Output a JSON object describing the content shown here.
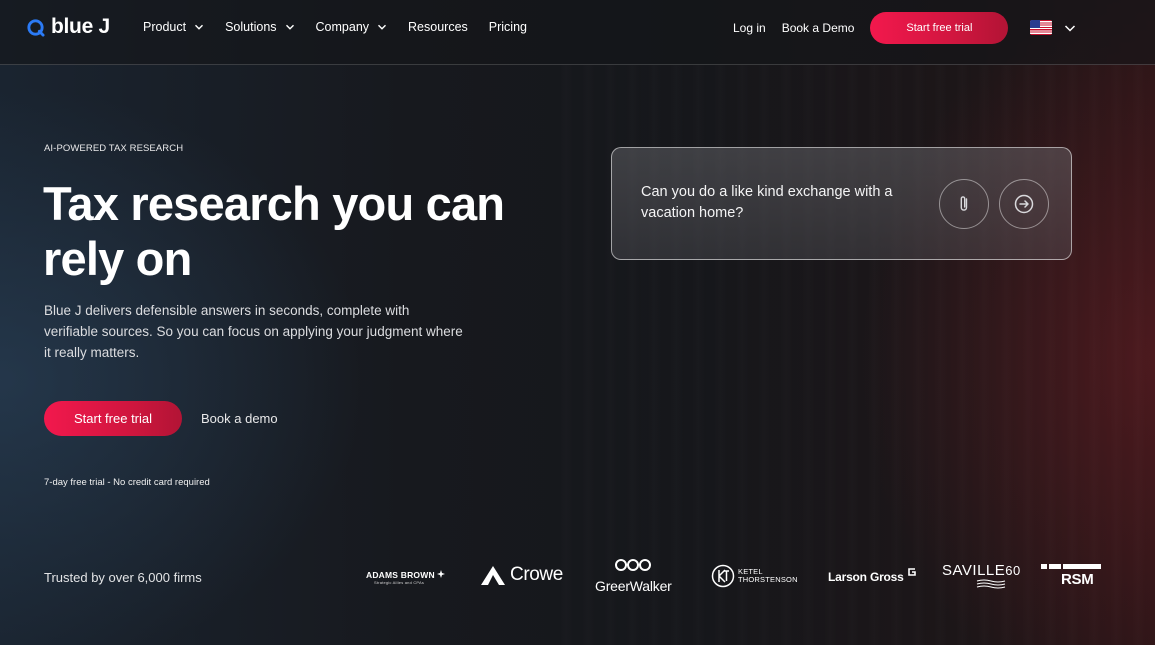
{
  "brand": {
    "name": "blue J",
    "accent": "#f2184d",
    "logo_blue": "#2b7bf6"
  },
  "nav": {
    "menu": [
      {
        "label": "Product",
        "has_dropdown": true
      },
      {
        "label": "Solutions",
        "has_dropdown": true
      },
      {
        "label": "Company",
        "has_dropdown": true
      },
      {
        "label": "Resources",
        "has_dropdown": false
      },
      {
        "label": "Pricing",
        "has_dropdown": false
      }
    ],
    "login": "Log in",
    "book_demo": "Book a Demo",
    "trial": "Start free trial",
    "language_icon": "us-flag-icon"
  },
  "hero": {
    "eyebrow": "AI-POWERED TAX RESEARCH",
    "headline": "Tax research you can rely on",
    "lede": "Blue J delivers defensible answers in seconds, complete with verifiable sources. So you can focus on applying your judgment where it really matters.",
    "cta_primary": "Start free trial",
    "cta_secondary": "Book a demo",
    "fineprint": "7-day free trial - No credit card required"
  },
  "chat": {
    "question": "Can you do a like kind exchange with a vacation home?",
    "attach_icon": "paperclip-icon",
    "send_icon": "arrow-right-circle-icon"
  },
  "trust": {
    "label": "Trusted by over 6,000 firms",
    "firms": {
      "adams": "ADAMS BROWN",
      "adams_tagline": "Strategic Allies and CPAs",
      "crowe": "Crowe",
      "greer": "GreerWalker",
      "ketel_line1": "KETEL",
      "ketel_line2": "THORSTENSON",
      "larson": "Larson Gross",
      "saville": "SAVILLE",
      "saville_num": "60",
      "rsm": "RSM"
    }
  }
}
